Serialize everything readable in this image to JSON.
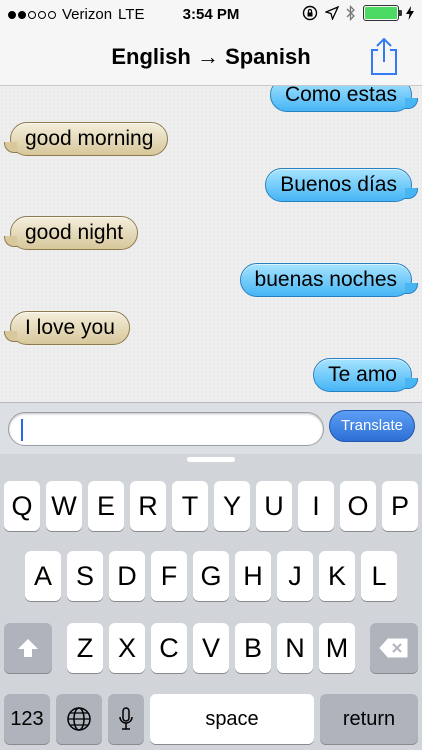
{
  "status": {
    "carrier": "Verizon",
    "network": "LTE",
    "time": "3:54 PM",
    "signal_bars_filled": 2,
    "signal_bars_total": 5,
    "battery_level": 1.0
  },
  "nav": {
    "from_lang": "English",
    "arrow": "→",
    "to_lang": "Spanish",
    "share_icon": "share-icon"
  },
  "messages": [
    {
      "side": "out",
      "text": "Como estas"
    },
    {
      "side": "in",
      "text": "good morning"
    },
    {
      "side": "out",
      "text": "Buenos días"
    },
    {
      "side": "in",
      "text": "good night"
    },
    {
      "side": "out",
      "text": "buenas noches"
    },
    {
      "side": "in",
      "text": "I love you"
    },
    {
      "side": "out",
      "text": "Te amo"
    }
  ],
  "input": {
    "value": "",
    "translate_label": "Translate"
  },
  "keyboard": {
    "row1": [
      "Q",
      "W",
      "E",
      "R",
      "T",
      "Y",
      "U",
      "I",
      "O",
      "P"
    ],
    "row2": [
      "A",
      "S",
      "D",
      "F",
      "G",
      "H",
      "J",
      "K",
      "L"
    ],
    "row3": [
      "Z",
      "X",
      "C",
      "V",
      "B",
      "N",
      "M"
    ],
    "numbers_label": "123",
    "space_label": "space",
    "return_label": "return"
  },
  "colors": {
    "incoming_bubble": "#d7c79b",
    "outgoing_bubble": "#46b5f5",
    "translate_button": "#2c6fd6",
    "battery": "#4cd964"
  }
}
